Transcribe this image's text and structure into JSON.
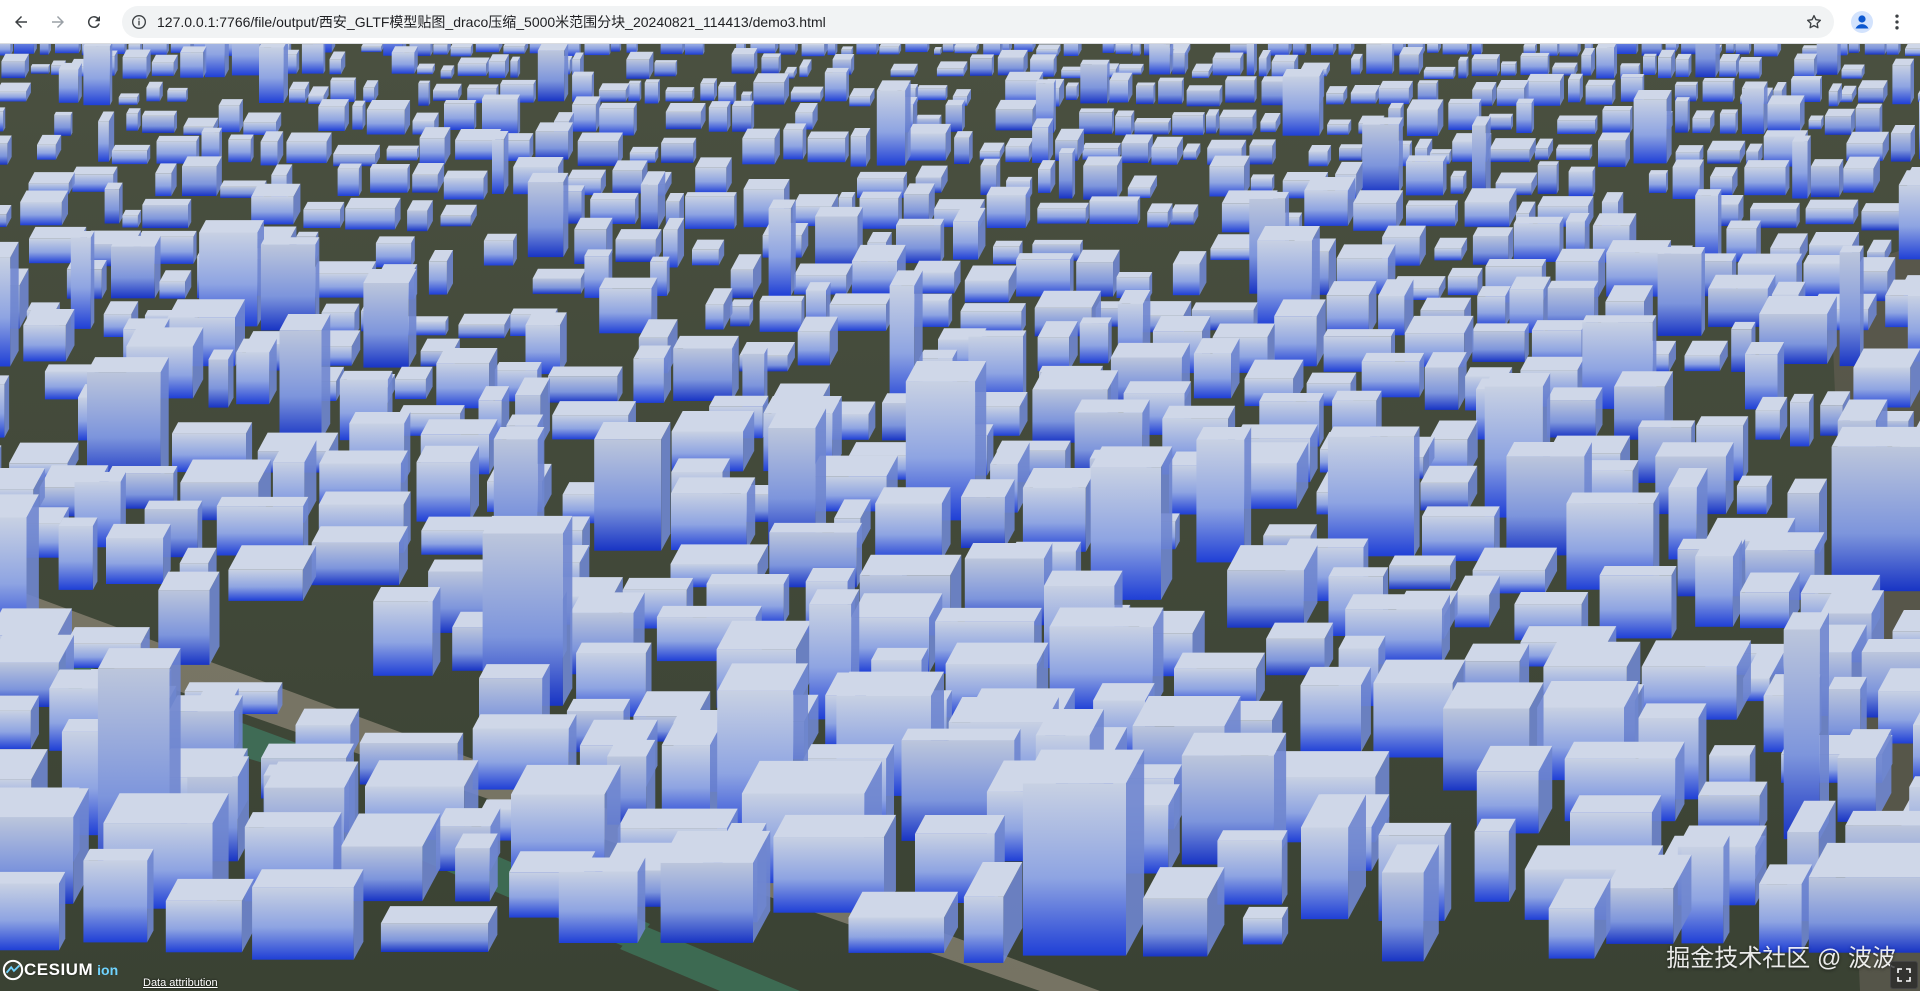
{
  "browser": {
    "url": "127.0.0.1:7766/file/output/西安_GLTF模型贴图_draco压缩_5000米范围分块_20240821_114413/demo3.html",
    "icons": {
      "back": "arrow-left-icon",
      "forward": "arrow-right-icon",
      "reload": "reload-icon",
      "site_info": "info-circle-icon",
      "bookmark": "star-icon",
      "profile": "person-icon",
      "menu": "kebab-menu-icon"
    }
  },
  "viewer": {
    "logo_text": "CESIUM",
    "logo_suffix": "ion",
    "attribution": "Data attribution",
    "watermark": "掘金技术社区 @ 波波",
    "colors": {
      "building_top": "#c9d3e6",
      "building_bottom": "#1e3fd8",
      "ground": "#3b4433",
      "road": "#6f6a5c",
      "river": "#3f6b55"
    }
  }
}
